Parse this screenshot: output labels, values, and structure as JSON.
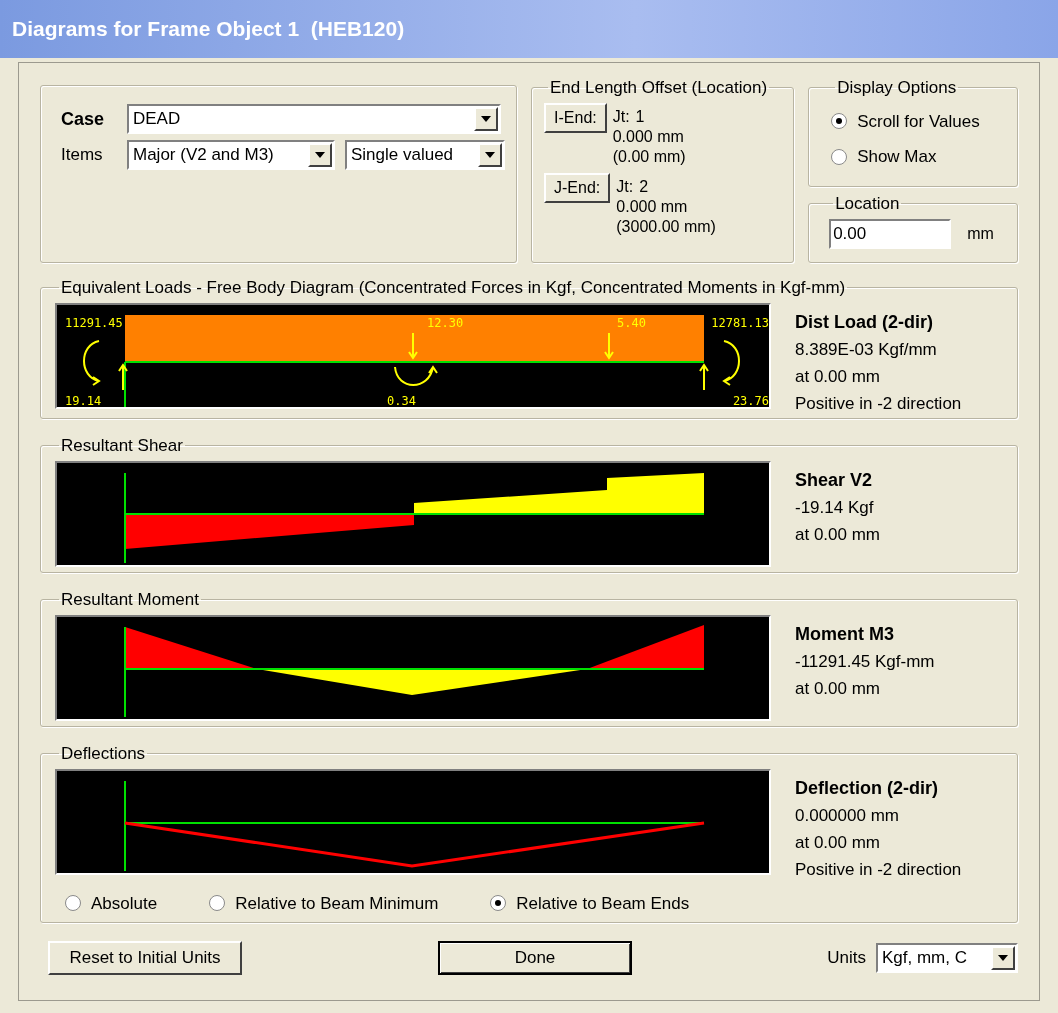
{
  "window": {
    "title": "Diagrams for Frame Object 1  (HEB120)"
  },
  "case": {
    "label": "Case",
    "value": "DEAD"
  },
  "items": {
    "label": "Items",
    "component": "Major (V2 and M3)",
    "valuing": "Single valued"
  },
  "end_length_offset": {
    "title": "End Length Offset (Location)",
    "ends": [
      {
        "button": "I-End:",
        "joint_label": "Jt:",
        "joint": "1",
        "offset": "0.000 mm",
        "location": "(0.00 mm)"
      },
      {
        "button": "J-End:",
        "joint_label": "Jt:",
        "joint": "2",
        "offset": "0.000 mm",
        "location": "(3000.00 mm)"
      }
    ]
  },
  "display_options": {
    "title": "Display Options",
    "options": [
      {
        "label": "Scroll for Values",
        "selected": true
      },
      {
        "label": "Show Max",
        "selected": false
      }
    ]
  },
  "location": {
    "title": "Location",
    "value": "0.00",
    "unit": "mm"
  },
  "panels": [
    {
      "kind": "loads",
      "title": "Equivalent Loads - Free Body Diagram  (Concentrated Forces in Kgf, Concentrated Moments in Kgf-mm)",
      "labels": [
        "11291.45",
        "12.30",
        "5.40",
        "12781.13",
        "19.14",
        "0.34",
        "23.76"
      ],
      "readout_title": "Dist Load (2-dir)",
      "readout": [
        "8.389E-03 Kgf/mm",
        "at 0.00 mm",
        "Positive in -2 direction"
      ]
    },
    {
      "kind": "shear",
      "title": "Resultant Shear",
      "readout_title": "Shear V2",
      "readout": [
        "-19.14 Kgf",
        "at 0.00 mm"
      ]
    },
    {
      "kind": "moment",
      "title": "Resultant Moment",
      "readout_title": "Moment M3",
      "readout": [
        "-11291.45 Kgf-mm",
        "at 0.00 mm"
      ]
    },
    {
      "kind": "deflection",
      "title": "Deflections",
      "readout_title": "Deflection (2-dir)",
      "readout": [
        "0.000000 mm",
        "at 0.00 mm",
        "Positive in -2 direction"
      ],
      "modes": [
        {
          "label": "Absolute",
          "selected": false
        },
        {
          "label": "Relative to Beam Minimum",
          "selected": false
        },
        {
          "label": "Relative to Beam Ends",
          "selected": true
        }
      ]
    }
  ],
  "reset_button": "Reset to Initial Units",
  "done_button": "Done",
  "units": {
    "label": "Units",
    "value": "Kgf, mm, C"
  }
}
